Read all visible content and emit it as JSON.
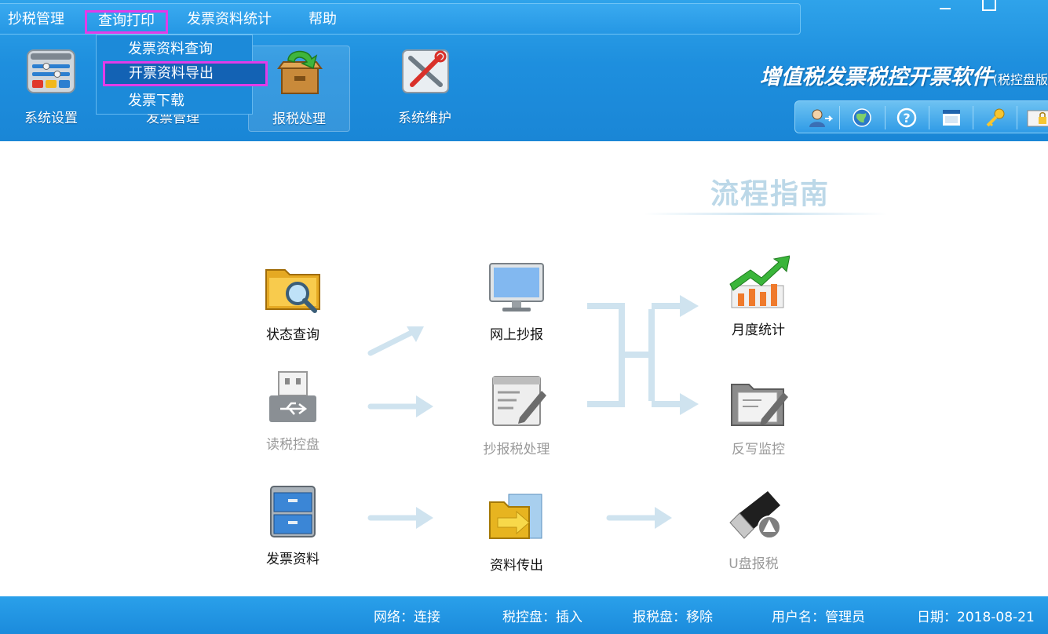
{
  "menubar": {
    "items": [
      "抄税管理",
      "查询打印",
      "发票资料统计",
      "帮助"
    ]
  },
  "dropdown": {
    "items": [
      "发票资料查询",
      "开票资料导出",
      "发票下载"
    ]
  },
  "toolbar": {
    "buttons": [
      {
        "label": "系统设置",
        "icon": "settings-panel-icon"
      },
      {
        "label": "发票管理",
        "icon": "invoice-icon"
      },
      {
        "label": "报税处理",
        "icon": "tax-box-icon"
      },
      {
        "label": "系统维护",
        "icon": "tools-icon"
      }
    ]
  },
  "brand": {
    "title": "增值税发票税控开票软件",
    "sub": "(税控盘版"
  },
  "quickbar": {
    "icons": [
      "user-switch-icon",
      "globe-icon",
      "help-icon",
      "window-icon",
      "key-icon",
      "lock-icon"
    ]
  },
  "guide": {
    "title": "流程指南",
    "nodes": {
      "status_query": "状态查询",
      "read_tax_disk": "读税控盘",
      "invoice_data": "发票资料",
      "online_report": "网上抄报",
      "report_process": "抄报税处理",
      "data_transfer": "资料传出",
      "monthly_stats": "月度统计",
      "write_back": "反写监控",
      "usb_report": "U盘报税"
    }
  },
  "status": {
    "network": "网络：连接",
    "tax_disk": "税控盘：插入",
    "report_disk": "报税盘：移除",
    "user": "用户名：管理员",
    "date": "日期：2018-08-21"
  },
  "colors": {
    "header_blue": "#1e8fde",
    "highlight": "#e23be8",
    "arrow": "#cfe3ef"
  }
}
